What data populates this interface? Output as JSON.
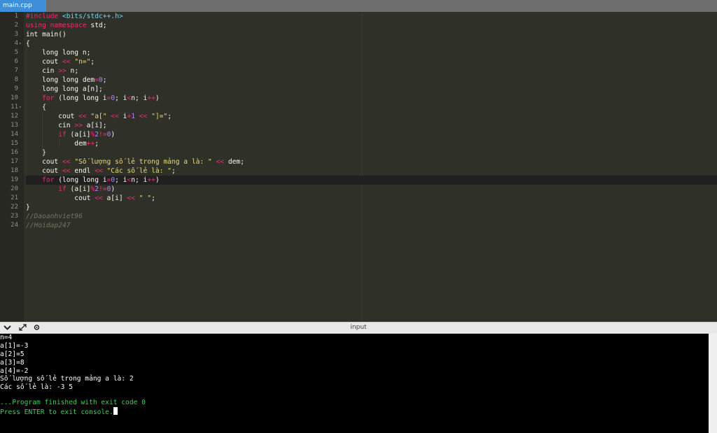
{
  "tab": {
    "label": "main.cpp"
  },
  "editor": {
    "line_numbers": [
      "1",
      "2",
      "3",
      "4",
      "5",
      "6",
      "7",
      "8",
      "9",
      "10",
      "11",
      "12",
      "13",
      "14",
      "15",
      "16",
      "17",
      "18",
      "19",
      "20",
      "21",
      "22",
      "23",
      "24"
    ],
    "code": {
      "l1a": "#include ",
      "l1b": "<bits/stdc++.h>",
      "l2a": "using namespace",
      "l2b": " std;",
      "l3": "int main()",
      "l4": "{",
      "l5": "    long long n;",
      "l6a": "    cout ",
      "l6b": "<< ",
      "l6c": "\"n=\"",
      "l6d": ";",
      "l7a": "    cin ",
      "l7b": ">> ",
      "l7c": "n;",
      "l8a": "    long long dem",
      "l8b": "=",
      "l8c": "0",
      "l8d": ";",
      "l9": "    long long a[n];",
      "l10a": "    ",
      "l10b": "for",
      "l10c": " (long long i",
      "l10d": "=",
      "l10e": "0",
      "l10f": "; i",
      "l10g": "<",
      "l10h": "n; i",
      "l10i": "++",
      "l10j": ")",
      "l11": "    {",
      "l12a": "        cout ",
      "l12b": "<< ",
      "l12c": "\"a[\"",
      "l12d": " << ",
      "l12e": "i",
      "l12f": "+",
      "l12g": "1",
      "l12h": " << ",
      "l12i": "\"]=\"",
      "l12j": ";",
      "l13a": "        cin ",
      "l13b": ">> ",
      "l13c": "a[i];",
      "l14a": "        ",
      "l14b": "if",
      "l14c": " (a[i]",
      "l14d": "%",
      "l14e": "2",
      "l14f": "!=",
      "l14g": "0",
      "l14h": ")",
      "l15a": "            dem",
      "l15b": "++",
      "l15c": ";",
      "l16": "    }",
      "l17a": "    cout ",
      "l17b": "<< ",
      "l17c": "\"Số lượng số lẻ trong mảng a là: \"",
      "l17d": " << ",
      "l17e": "dem;",
      "l18a": "    cout ",
      "l18b": "<< ",
      "l18c": "endl ",
      "l18d": "<< ",
      "l18e": "\"Các số lẻ là: \"",
      "l18f": ";",
      "l19a": "    ",
      "l19b": "for",
      "l19c": " (long long i",
      "l19d": "=",
      "l19e": "0",
      "l19f": "; i",
      "l19g": "<",
      "l19h": "n; i",
      "l19i": "++",
      "l19j": ")",
      "l20a": "        ",
      "l20b": "if",
      "l20c": " (a[i]",
      "l20d": "%",
      "l20e": "2",
      "l20f": "!=",
      "l20g": "0",
      "l20h": ")",
      "l21a": "            cout ",
      "l21b": "<< ",
      "l21c": "a[i] ",
      "l21d": "<< ",
      "l21e": "\" \"",
      "l21f": ";",
      "l22": "}",
      "l23": "//Daoanhviet96",
      "l24": "//Hoidap247"
    }
  },
  "panel": {
    "title": "input",
    "icons": [
      "chevron-down-icon",
      "expand-icon",
      "settings-icon"
    ]
  },
  "console": {
    "lines": [
      "n=4",
      "a[1]=-3",
      "a[2]=5",
      "a[3]=8",
      "a[4]=-2",
      "Số lượng số lẻ trong mảng a là: 2",
      "Các số lẻ là: -3 5",
      "",
      "...Program finished with exit code 0",
      "Press ENTER to exit console."
    ]
  },
  "colors": {
    "tab_accent": "#3c8fd8",
    "editor_bg": "#2f3129",
    "console_bg": "#000000",
    "console_green": "#39d353"
  }
}
